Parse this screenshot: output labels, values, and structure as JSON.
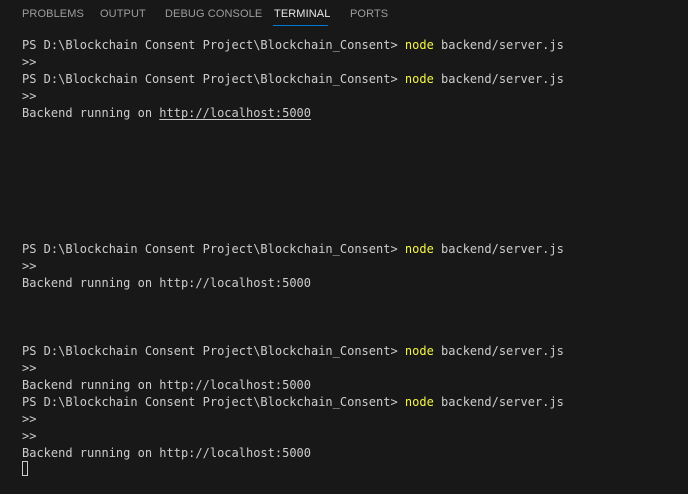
{
  "tabs": [
    {
      "label": "PROBLEMS"
    },
    {
      "label": "OUTPUT"
    },
    {
      "label": "DEBUG CONSOLE"
    },
    {
      "label": "TERMINAL"
    },
    {
      "label": "PORTS"
    }
  ],
  "active_tab": "TERMINAL",
  "colors": {
    "background": "#181818",
    "text": "#cccccc",
    "command": "#f5f543",
    "active_tab_underline": "#0078d4"
  },
  "terminal": {
    "prompt": "PS D:\\Blockchain Consent Project\\Blockchain_Consent> ",
    "command_word": "node",
    "command_args": " backend/server.js",
    "continuation": ">>",
    "output_prefix": "Backend running on ",
    "output_url": "http://localhost:5000"
  }
}
